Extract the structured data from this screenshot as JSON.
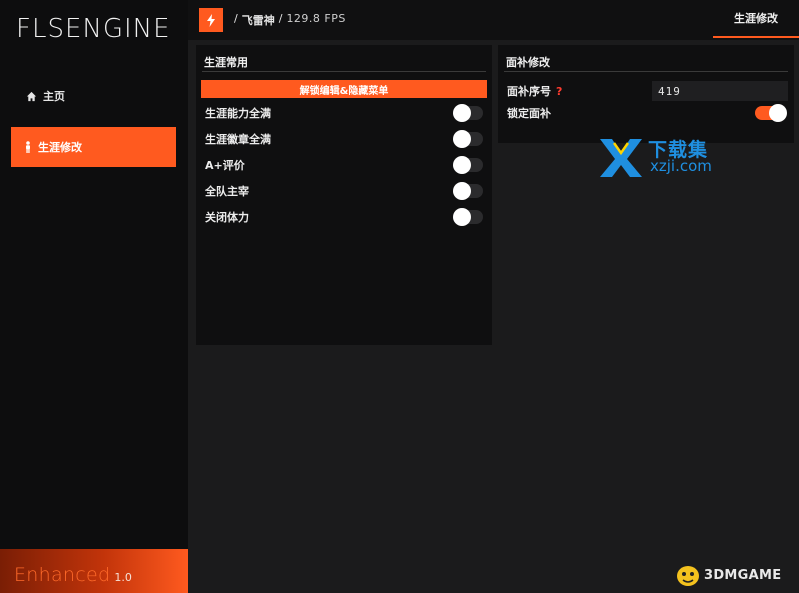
{
  "app": {
    "logo": "FLSENGINE",
    "brand": "Enhanced",
    "version": "1.0"
  },
  "sidebar": {
    "items": [
      {
        "label": "主页",
        "icon": "home-icon",
        "active": false
      },
      {
        "label": "生涯修改",
        "icon": "person-icon",
        "active": true
      }
    ]
  },
  "topbar": {
    "icon": "bolt-icon",
    "separator": "/",
    "game": "飞雷神",
    "fps": "129.8 FPS",
    "tab": "生涯修改"
  },
  "career_panel": {
    "title": "生涯常用",
    "action_button": "解锁编辑&隐藏菜单",
    "toggles": [
      {
        "label": "生涯能力全满",
        "on": false
      },
      {
        "label": "生涯徽章全满",
        "on": false
      },
      {
        "label": "A+评价",
        "on": false
      },
      {
        "label": "全队主宰",
        "on": false
      },
      {
        "label": "关闭体力",
        "on": false
      }
    ]
  },
  "face_panel": {
    "title": "面补修改",
    "field_label": "面补序号",
    "help_icon": "?",
    "field_value": "419",
    "toggle_label": "锁定面补",
    "toggle_on": true
  },
  "watermarks": {
    "xz_title": "下载集",
    "xz_url": "xzji.com",
    "dm": "3DMGAME"
  },
  "colors": {
    "accent": "#ff5a1f",
    "background": "#1b1b1c",
    "panel": "#0f0f10",
    "watermark_blue": "#1f8fe0"
  }
}
